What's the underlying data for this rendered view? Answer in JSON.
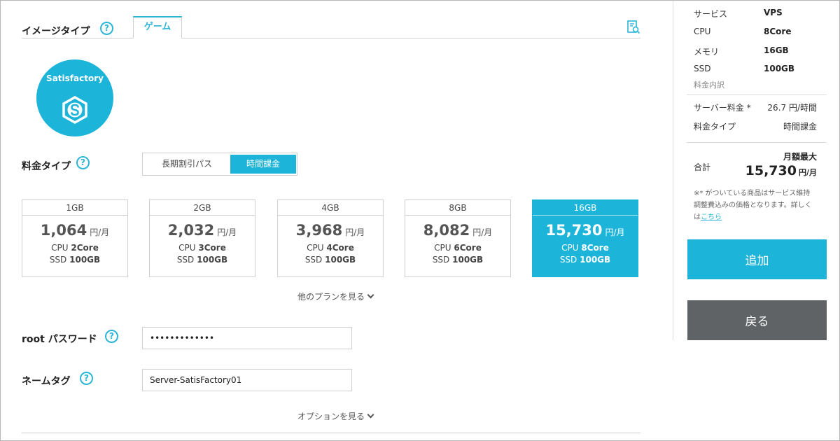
{
  "image_type": {
    "label": "イメージタイプ",
    "help": "?",
    "tab": "ゲーム"
  },
  "app_logo": {
    "name": "Satisfactory"
  },
  "pricing_type": {
    "label": "料金タイプ",
    "help": "?",
    "options": [
      "長期割引パス",
      "時間課金"
    ],
    "selected": "時間課金"
  },
  "plans": [
    {
      "memory": "1GB",
      "price": "1,064",
      "unit": "円/月",
      "cpu_label": "CPU",
      "cpu": "2Core",
      "ssd_label": "SSD",
      "ssd": "100GB",
      "selected": false
    },
    {
      "memory": "2GB",
      "price": "2,032",
      "unit": "円/月",
      "cpu_label": "CPU",
      "cpu": "3Core",
      "ssd_label": "SSD",
      "ssd": "100GB",
      "selected": false
    },
    {
      "memory": "4GB",
      "price": "3,968",
      "unit": "円/月",
      "cpu_label": "CPU",
      "cpu": "4Core",
      "ssd_label": "SSD",
      "ssd": "100GB",
      "selected": false
    },
    {
      "memory": "8GB",
      "price": "8,082",
      "unit": "円/月",
      "cpu_label": "CPU",
      "cpu": "6Core",
      "ssd_label": "SSD",
      "ssd": "100GB",
      "selected": false
    },
    {
      "memory": "16GB",
      "price": "15,730",
      "unit": "円/月",
      "cpu_label": "CPU",
      "cpu": "8Core",
      "ssd_label": "SSD",
      "ssd": "100GB",
      "selected": true
    }
  ],
  "more_plans": "他のプランを見る",
  "root_password": {
    "label": "root パスワード",
    "help": "?",
    "value": "•••••••••••••"
  },
  "name_tag": {
    "label": "ネームタグ",
    "help": "?",
    "value": "Server-SatisFactory01"
  },
  "more_options": "オプションを見る",
  "sidebar": {
    "service": {
      "label": "サービス",
      "value": "VPS"
    },
    "cpu": {
      "label": "CPU",
      "value": "8Core"
    },
    "memory": {
      "label": "メモリ",
      "value": "16GB"
    },
    "ssd": {
      "label": "SSD",
      "value": "100GB"
    },
    "breakdown": "料金内訳",
    "server_fee": {
      "label": "サーバー料金 *",
      "value": "26.7 円/時間"
    },
    "fee_type": {
      "label": "料金タイプ",
      "value": "時間課金"
    },
    "total": {
      "label": "合計",
      "max_label": "月額最大",
      "price": "15,730",
      "unit": "円/月"
    },
    "disclaimer": "※* がついている商品はサービス維持調整費込みの価格となります。詳しくは",
    "disclaimer_link": "こちら",
    "add_button": "追加",
    "back_button": "戻る"
  },
  "colors": {
    "accent": "#1cb4d8",
    "back_button": "#5f6366"
  }
}
